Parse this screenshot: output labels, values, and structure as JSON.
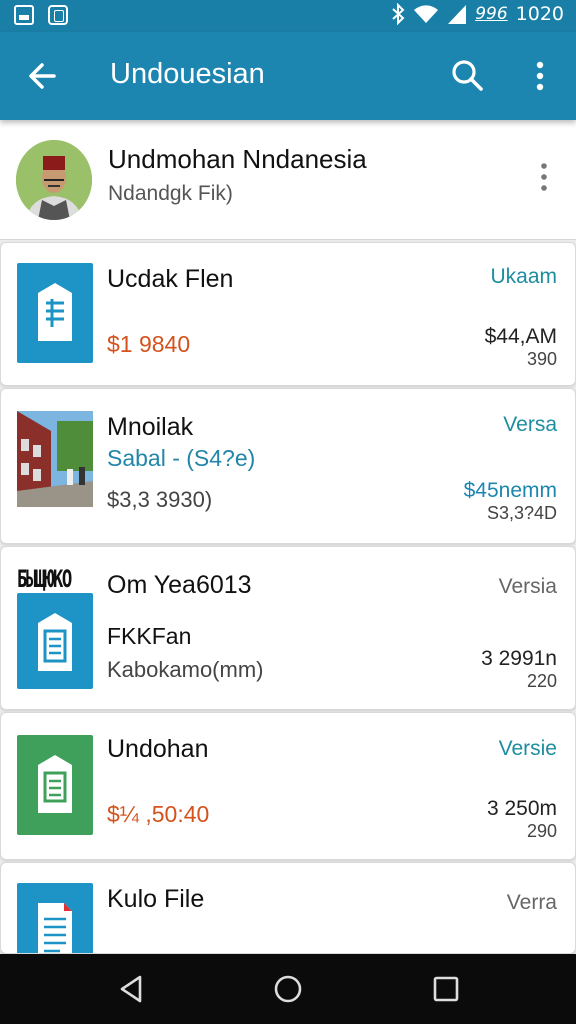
{
  "status_bar": {
    "time": "1020",
    "battery_text": "996",
    "icons": [
      "gallery-icon",
      "app-icon",
      "bluetooth-icon",
      "wifi-icon",
      "signal-icon"
    ]
  },
  "app_bar": {
    "title": "Undouesian",
    "back_icon": "arrow-back-icon",
    "search_icon": "search-icon",
    "more_icon": "more-vert-icon",
    "color": "#1d86b0"
  },
  "profile": {
    "name": "Undmohan Nndanesia",
    "subtitle": "Ndandgk Fik)"
  },
  "items": [
    {
      "title": "Ucdak Flen",
      "price": "$1 9840",
      "badge": "Ukaam",
      "amount": "$44,AM",
      "amount_sub": "390",
      "icon": "document-icon"
    },
    {
      "title": "Mnoilak",
      "subtitle": "Sabal - (S4?e)",
      "price": "$3,3 3930)",
      "badge": "Versa",
      "amount": "$45nemm",
      "amount_sub": "S3,3?4D",
      "icon": "photo-thumbnail"
    },
    {
      "stamp": "БЫЩЮКО",
      "title": "Om Yea6013",
      "subtitle": "FKKFan",
      "detail": "Kabokamo(mm)",
      "badge": "Versia",
      "amount": "3 2991n",
      "amount_sub": "220",
      "icon": "document-icon"
    },
    {
      "title": "Undohan",
      "price": "$¼ ,50:40",
      "badge": "Versie",
      "amount": "3 250m",
      "amount_sub": "290",
      "icon": "document-icon"
    },
    {
      "title": "Kulo File",
      "badge": "Verra",
      "icon": "file-icon"
    }
  ],
  "nav": {
    "back": "nav-back-icon",
    "home": "nav-home-icon",
    "recents": "nav-recents-icon"
  },
  "colors": {
    "primary": "#1d86b0",
    "status_bar": "#1a7fa6",
    "price": "#d4531c",
    "teal": "#1d8ea0",
    "thumb_blue": "#1e93c6",
    "thumb_green": "#3ea05a"
  }
}
